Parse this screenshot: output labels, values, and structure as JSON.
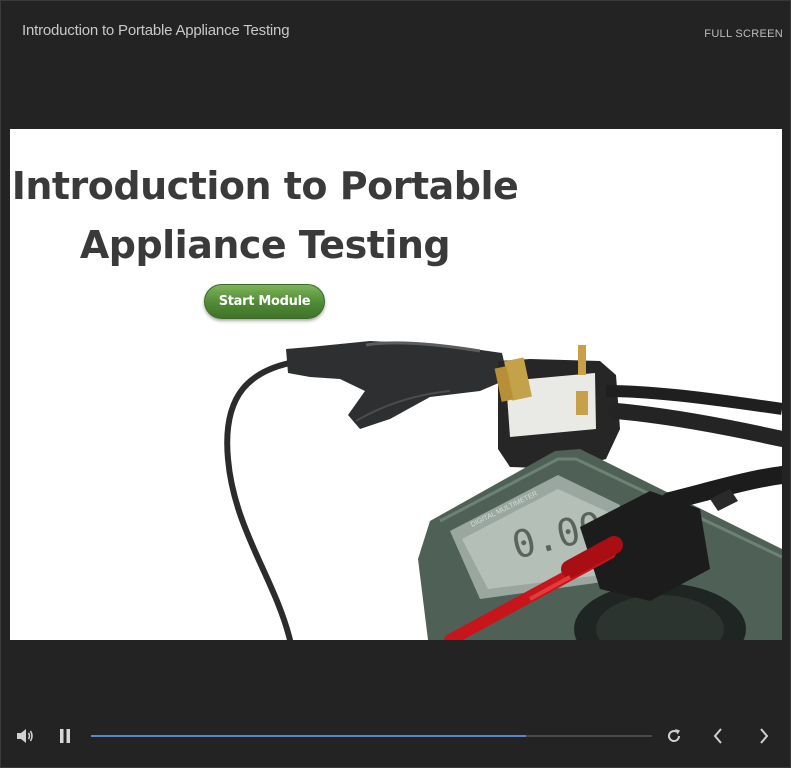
{
  "header": {
    "title": "Introduction to Portable Appliance Testing",
    "fullscreen_label": "FULL SCREEN"
  },
  "slide": {
    "title_line1": "Introduction to Portable",
    "title_line2": "Appliance Testing",
    "start_button_label": "Start Module",
    "multimeter_brand": "DIGITAL MULTIMETER",
    "multimeter_display": "0.00"
  },
  "controls": {
    "icons": [
      "volume-icon",
      "pause-icon",
      "replay-icon",
      "previous-icon",
      "next-icon"
    ],
    "progress_fraction": 0.775
  },
  "colors": {
    "background": "#232323",
    "progress_fill": "#5b86c7",
    "start_button": "#5a9440"
  }
}
